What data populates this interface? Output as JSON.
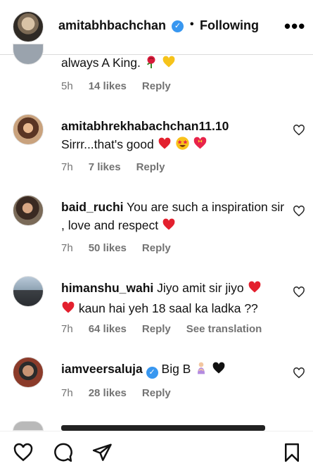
{
  "header": {
    "username": "amitabhbachchan",
    "separator": "•",
    "follow_status": "Following",
    "more": "•••"
  },
  "comments": [
    {
      "username": "",
      "text": "always A King.",
      "emojis": [
        "rose",
        "yellow-heart"
      ],
      "time": "5h",
      "likes": "14 likes",
      "reply": "Reply",
      "translation": "",
      "verified": false
    },
    {
      "username": "amitabhrekhabachchan11.10",
      "text": "Sirrr...that's good",
      "emojis": [
        "red-heart",
        "star-struck",
        "heart-with-ribbon"
      ],
      "time": "7h",
      "likes": "7 likes",
      "reply": "Reply",
      "translation": "",
      "verified": false
    },
    {
      "username": "baid_ruchi",
      "text": "You are such a inspiration sir , love and respect",
      "emojis": [
        "red-heart"
      ],
      "time": "7h",
      "likes": "50 likes",
      "reply": "Reply",
      "translation": "",
      "verified": false
    },
    {
      "username": "himanshu_wahi",
      "text_before": "Jiyo amit sir jiyo",
      "text_after": "kaun hai yeh 18 saal ka ladka ??",
      "emojis": [
        "red-heart",
        "red-heart"
      ],
      "time": "7h",
      "likes": "64 likes",
      "reply": "Reply",
      "translation": "See translation",
      "verified": false
    },
    {
      "username": "iamveersaluja",
      "text": "Big B",
      "emojis": [
        "person-bowing",
        "black-heart"
      ],
      "time": "7h",
      "likes": "28 likes",
      "reply": "Reply",
      "translation": "",
      "verified": true
    }
  ],
  "colors": {
    "verified": "#3897f0",
    "meta": "#737373",
    "heart": "#e0245e",
    "divider": "#dbdbdb"
  },
  "bottom_bar": {
    "icons": [
      "like-icon",
      "comment-icon",
      "share-icon",
      "save-icon"
    ]
  }
}
